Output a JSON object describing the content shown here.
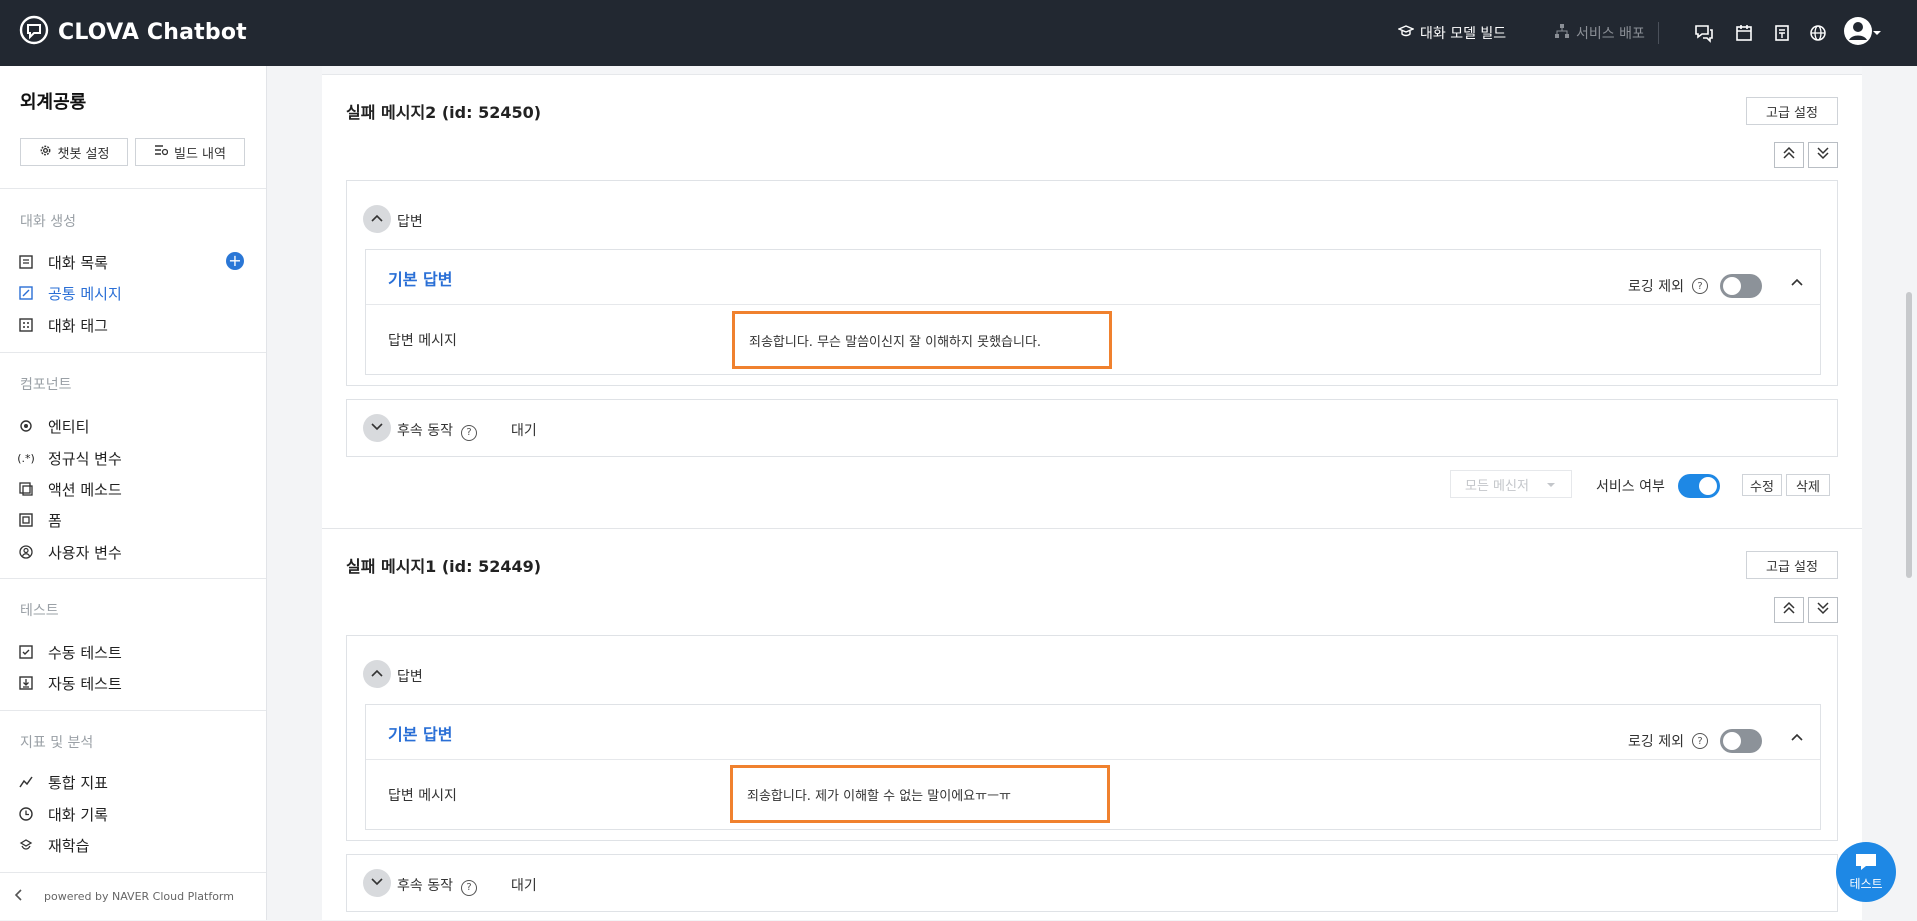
{
  "header": {
    "brand": "CLOVA Chatbot",
    "build_label": "대화 모델 빌드",
    "deploy_label": "서비스 배포"
  },
  "sidebar": {
    "project_name": "외계공룡",
    "settings_button": "챗봇 설정",
    "history_button": "빌드 내역",
    "sections": [
      {
        "title": "대화 생성",
        "items": [
          {
            "label": "대화 목록"
          },
          {
            "label": "공통 메시지"
          },
          {
            "label": "대화 태그"
          }
        ]
      },
      {
        "title": "컴포넌트",
        "items": [
          {
            "label": "엔티티"
          },
          {
            "label": "정규식 변수"
          },
          {
            "label": "액션 메소드"
          },
          {
            "label": "폼"
          },
          {
            "label": "사용자 변수"
          }
        ]
      },
      {
        "title": "테스트",
        "items": [
          {
            "label": "수동 테스트"
          },
          {
            "label": "자동 테스트"
          }
        ]
      },
      {
        "title": "지표 및 분석",
        "items": [
          {
            "label": "통합 지표"
          },
          {
            "label": "대화 기록"
          },
          {
            "label": "재학습"
          }
        ]
      }
    ],
    "footer": "powered by NAVER Cloud Platform"
  },
  "messages": [
    {
      "title": "실패 메시지2 (id: 52450)",
      "advanced_label": "고급 설정",
      "answer_label": "답변",
      "default_answer_label": "기본 답변",
      "logging_label": "로깅 제외",
      "message_label": "답변 메시지",
      "message_text": "죄송합니다. 무슨 말씀이신지 잘 이해하지 못했습니다.",
      "follow_label": "후속 동작",
      "follow_value": "대기",
      "messenger_placeholder": "모든 메신저",
      "service_label": "서비스 여부",
      "edit_label": "수정",
      "delete_label": "삭제"
    },
    {
      "title": "실패 메시지1 (id: 52449)",
      "advanced_label": "고급 설정",
      "answer_label": "답변",
      "default_answer_label": "기본 답변",
      "logging_label": "로깅 제외",
      "message_label": "답변 메시지",
      "message_text": "죄송합니다. 제가 이해할 수 없는 말이에요ㅠㅡㅠ",
      "follow_label": "후속 동작",
      "follow_value": "대기"
    }
  ],
  "fab": {
    "label": "테스트"
  },
  "colors": {
    "header_bg": "#222831",
    "accent": "#1e88e5",
    "highlight": "#f0812e"
  }
}
